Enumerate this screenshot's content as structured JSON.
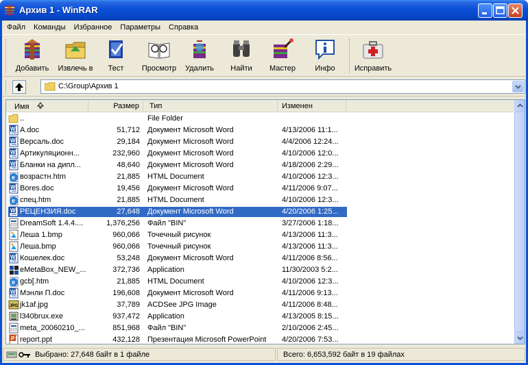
{
  "window": {
    "title": "Архив 1 - WinRAR"
  },
  "menu": [
    "Файл",
    "Команды",
    "Избранное",
    "Параметры",
    "Справка"
  ],
  "toolbar": {
    "add": "Добавить",
    "extract": "Извлечь в",
    "test": "Тест",
    "view": "Просмотр",
    "delete": "Удалить",
    "find": "Найти",
    "wizard": "Мастер",
    "info": "Инфо",
    "repair": "Исправить"
  },
  "address": {
    "path": "C:\\Group\\Архив 1"
  },
  "columns": {
    "name": "Имя",
    "size": "Размер",
    "type": "Тип",
    "modified": "Изменен"
  },
  "files": [
    {
      "name": "..",
      "size": "",
      "type": "File Folder",
      "modified": "",
      "icon": "folder-icon"
    },
    {
      "name": "A.doc",
      "size": "51,712",
      "type": "Документ Microsoft Word",
      "modified": "4/13/2006 11:1...",
      "icon": "word-doc-icon"
    },
    {
      "name": "Версаль.doc",
      "size": "29,184",
      "type": "Документ Microsoft Word",
      "modified": "4/4/2006 12:24...",
      "icon": "word-doc-icon"
    },
    {
      "name": "Артикуляционн...",
      "size": "232,960",
      "type": "Документ Microsoft Word",
      "modified": "4/10/2006 12:0...",
      "icon": "word-doc-icon"
    },
    {
      "name": "Бланки на дипл...",
      "size": "48,640",
      "type": "Документ Microsoft Word",
      "modified": "4/18/2006 2:29...",
      "icon": "word-doc-icon"
    },
    {
      "name": "возрастн.htm",
      "size": "21,885",
      "type": "HTML Document",
      "modified": "4/10/2006 12:3...",
      "icon": "html-icon"
    },
    {
      "name": "Bores.doc",
      "size": "19,456",
      "type": "Документ Microsoft Word",
      "modified": "4/11/2006 9:07...",
      "icon": "word-doc-icon"
    },
    {
      "name": "спец.htm",
      "size": "21,885",
      "type": "HTML Document",
      "modified": "4/10/2006 12:3...",
      "icon": "html-icon"
    },
    {
      "name": "РЕЦЕНЗИЯ.doc",
      "size": "27,648",
      "type": "Документ Microsoft Word",
      "modified": "4/20/2006 1:25...",
      "icon": "word-doc-icon",
      "selected": true
    },
    {
      "name": "DreamSoft 1.4.4....",
      "size": "1,376,256",
      "type": "Файл \"BIN\"",
      "modified": "3/27/2006 1:18...",
      "icon": "bin-file-icon"
    },
    {
      "name": "Леша 1.bmp",
      "size": "960,066",
      "type": "Точечный рисунок",
      "modified": "4/13/2006 11:3...",
      "icon": "bitmap-icon"
    },
    {
      "name": "Леша.bmp",
      "size": "960,066",
      "type": "Точечный рисунок",
      "modified": "4/13/2006 11:3...",
      "icon": "bitmap-icon"
    },
    {
      "name": "Кошелек.doc",
      "size": "53,248",
      "type": "Документ Microsoft Word",
      "modified": "4/11/2006 8:56...",
      "icon": "word-doc-icon"
    },
    {
      "name": "eMetaBox_NEW_...",
      "size": "372,736",
      "type": "Application",
      "modified": "11/30/2003 5:2...",
      "icon": "emetabox-app-icon"
    },
    {
      "name": "gcb[.htm",
      "size": "21,885",
      "type": "HTML Document",
      "modified": "4/10/2006 12:3...",
      "icon": "html-icon"
    },
    {
      "name": "Мэнли П.doc",
      "size": "196,608",
      "type": "Документ Microsoft Word",
      "modified": "4/11/2006 9:13...",
      "icon": "word-doc-icon"
    },
    {
      "name": "jk1af.jpg",
      "size": "37,789",
      "type": "ACDSee JPG Image",
      "modified": "4/11/2006 8:48...",
      "icon": "jpg-icon"
    },
    {
      "name": "l340brux.exe",
      "size": "937,472",
      "type": "Application",
      "modified": "4/13/2005 8:15...",
      "icon": "exe-app-icon"
    },
    {
      "name": "meta_20060210_...",
      "size": "851,968",
      "type": "Файл \"BIN\"",
      "modified": "2/10/2006 2:45...",
      "icon": "bin-file-icon"
    },
    {
      "name": "report.ppt",
      "size": "432,128",
      "type": "Презентация Microsoft PowerPoint",
      "modified": "4/20/2006 7:53...",
      "icon": "ppt-icon"
    }
  ],
  "status": {
    "selected": "Выбрано: 27,648 байт в 1 файле",
    "total": "Всего: 6,653,592 байт в 19 файлах"
  }
}
